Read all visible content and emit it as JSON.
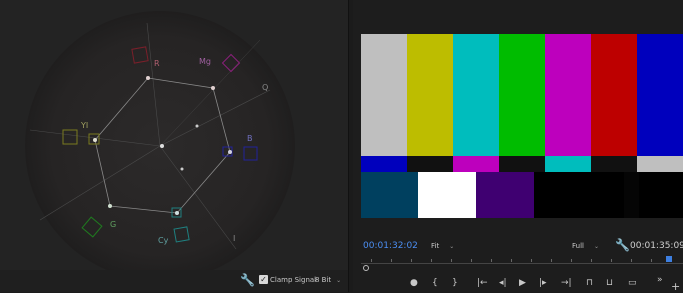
{
  "scope": {
    "labels": {
      "R": "R",
      "Mg": "Mg",
      "B": "B",
      "Cy": "Cy",
      "G": "G",
      "Yl": "YI",
      "Q": "Q",
      "I": "I"
    },
    "clamp_label": "Clamp Signal",
    "bit_depth": "8 Bit",
    "wrench_icon": "wrench-icon"
  },
  "monitor": {
    "timecode_current": "00:01:32:02",
    "timecode_duration": "00:01:35:09",
    "fit_label": "Fit",
    "quality_label": "Full",
    "colors": {
      "gray": "#bfbfbf",
      "yellow": "#bdbd00",
      "cyan": "#00bdbd",
      "green": "#00bc00",
      "magenta": "#bd00bd",
      "red": "#bd0000",
      "blue": "#0000bd",
      "navy": "#00405f",
      "white": "#ffffff",
      "purple": "#3f0071",
      "timecode": "#4b8ef2"
    },
    "controls": [
      "marker",
      "in-point",
      "out-point",
      "go-to-in",
      "step-back",
      "play",
      "step-forward",
      "go-to-out",
      "lift",
      "extract",
      "export-frame",
      "more",
      "add"
    ]
  }
}
